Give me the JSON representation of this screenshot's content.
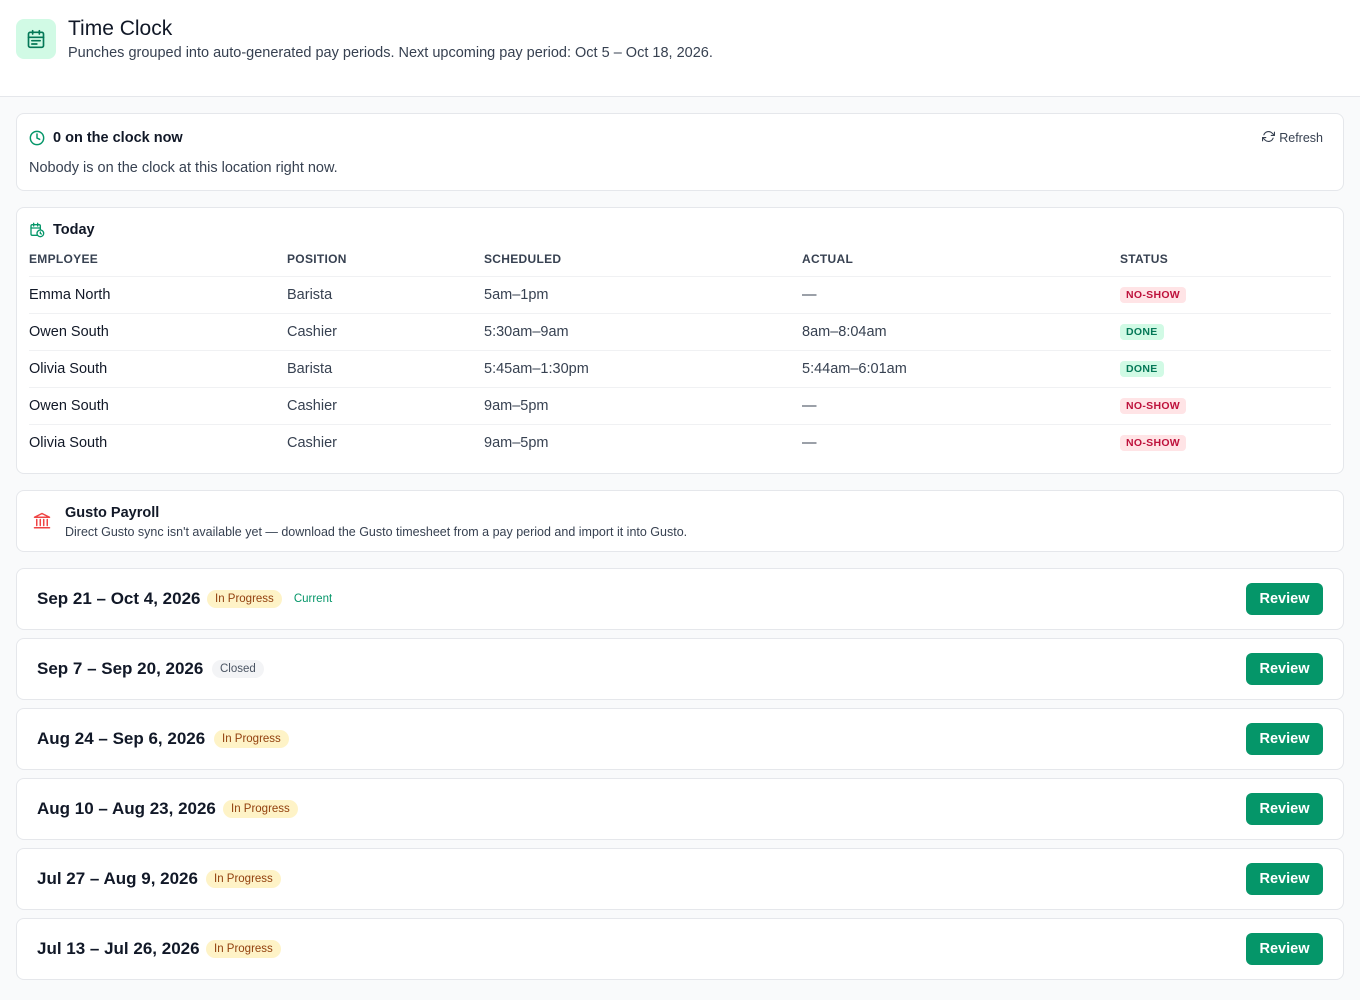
{
  "header": {
    "title": "Time Clock",
    "subtitle": "Punches grouped into auto-generated pay periods. Next upcoming pay period: Oct 5 – Oct 18, 2026.",
    "icon": "calendar-icon"
  },
  "on_clock": {
    "title": "0 on the clock now",
    "empty_message": "Nobody is on the clock at this location right now.",
    "refresh_label": "Refresh"
  },
  "today": {
    "title": "Today",
    "columns": [
      "EMPLOYEE",
      "POSITION",
      "SCHEDULED",
      "ACTUAL",
      "STATUS"
    ],
    "rows": [
      {
        "employee": "Emma North",
        "position": "Barista",
        "scheduled": "5am–1pm",
        "actual": "—",
        "status": "NO-SHOW"
      },
      {
        "employee": "Owen South",
        "position": "Cashier",
        "scheduled": "5:30am–9am",
        "actual": "8am–8:04am",
        "status": "DONE"
      },
      {
        "employee": "Olivia South",
        "position": "Barista",
        "scheduled": "5:45am–1:30pm",
        "actual": "5:44am–6:01am",
        "status": "DONE"
      },
      {
        "employee": "Owen South",
        "position": "Cashier",
        "scheduled": "9am–5pm",
        "actual": "—",
        "status": "NO-SHOW"
      },
      {
        "employee": "Olivia South",
        "position": "Cashier",
        "scheduled": "9am–5pm",
        "actual": "—",
        "status": "NO-SHOW"
      }
    ]
  },
  "gusto": {
    "title": "Gusto Payroll",
    "message": "Direct Gusto sync isn't available yet — download the Gusto timesheet from a pay period and import it into Gusto."
  },
  "pay_periods": [
    {
      "label": "Sep 21 – Oct 4, 2026",
      "status": "In Progress",
      "current": "Current",
      "review_label": "Review"
    },
    {
      "label": "Sep 7 – Sep 20, 2026",
      "status": "Closed",
      "review_label": "Review"
    },
    {
      "label": "Aug 24 – Sep 6, 2026",
      "status": "In Progress",
      "review_label": "Review"
    },
    {
      "label": "Aug 10 – Aug 23, 2026",
      "status": "In Progress",
      "review_label": "Review"
    },
    {
      "label": "Jul 27 – Aug 9, 2026",
      "status": "In Progress",
      "review_label": "Review"
    },
    {
      "label": "Jul 13 – Jul 26, 2026",
      "status": "In Progress",
      "review_label": "Review"
    }
  ],
  "colors": {
    "accent": "#059669",
    "no_show_bg": "#ffe4e6",
    "no_show_text": "#be123c",
    "done_bg": "#d1fae5",
    "done_text": "#047857",
    "in_progress_bg": "#fef3c7",
    "in_progress_text": "#92400e",
    "gusto_icon": "#ef4444"
  }
}
